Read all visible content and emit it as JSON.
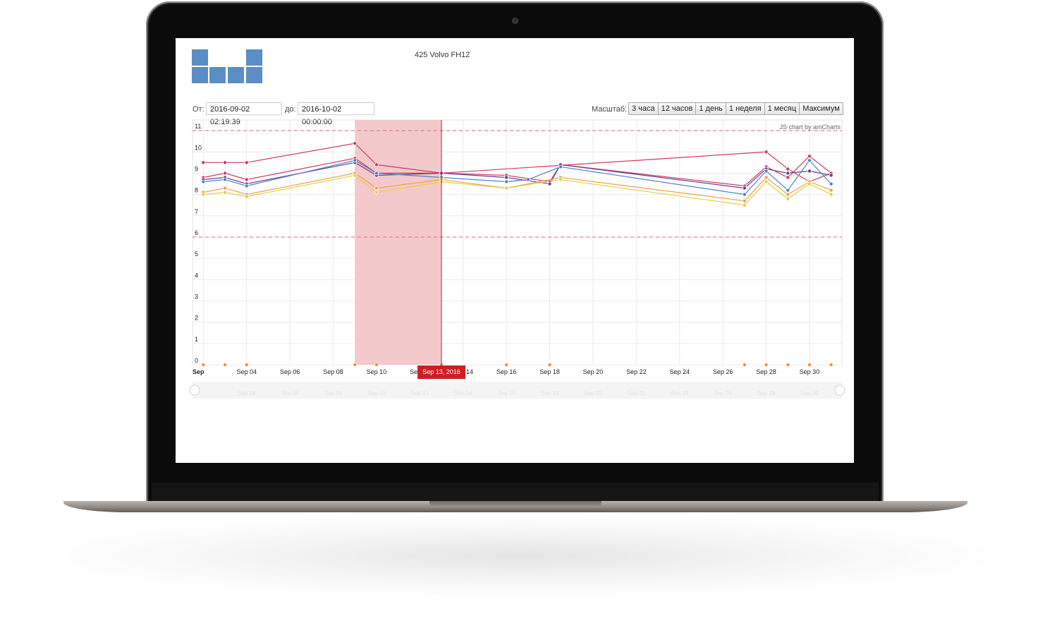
{
  "header": {
    "title": "425 Volvo FH12"
  },
  "period": {
    "from_label": "От:",
    "from_value": "2016-09-02 02:19:39",
    "to_label": "до:",
    "to_value": "2016-10-02 00:00:00"
  },
  "zoom": {
    "label": "Масштаб:",
    "buttons": [
      "3 часа",
      "12 часов",
      "1 день",
      "1 неделя",
      "1 месяц",
      "Максимум"
    ]
  },
  "chart_credit": "JS chart by amCharts",
  "cursor_label": "Sep 13, 2016",
  "colors": {
    "red": "#d13a63",
    "purple": "#6b3f8c",
    "blue": "#4a86c8",
    "orange": "#f0a04b",
    "yellow": "#e3d13c",
    "guide": "#e06a7b",
    "selection": "#f3c9cc",
    "cursor": "#cc1f24"
  },
  "chart_data": {
    "type": "line",
    "y_ticks": [
      "0",
      "1",
      "2",
      "3",
      "4",
      "5",
      "6",
      "7",
      "8",
      "9",
      "10",
      "11"
    ],
    "ylim": [
      0,
      11.5
    ],
    "guides": [
      6,
      11
    ],
    "x_ticks": [
      "Sep",
      "Sep 04",
      "Sep 06",
      "Sep 08",
      "Sep 10",
      "Sep 12",
      "Sep 14",
      "Sep 16",
      "Sep 18",
      "Sep 20",
      "Sep 22",
      "Sep 24",
      "Sep 26",
      "Sep 28",
      "Sep 30"
    ],
    "x_tick_days": [
      2,
      4,
      6,
      8,
      10,
      12,
      14,
      16,
      18,
      20,
      22,
      24,
      26,
      28,
      30
    ],
    "xlim_days": [
      1.5,
      31.5
    ],
    "selection_days": [
      9.0,
      13.0
    ],
    "cursor_day": 13.0,
    "series": [
      {
        "color": "red",
        "points": [
          [
            2,
            9.5
          ],
          [
            3,
            9.5
          ],
          [
            4,
            9.5
          ],
          [
            9,
            10.4
          ],
          [
            10,
            9.4
          ],
          [
            13,
            9.0
          ],
          [
            28,
            10.0
          ],
          [
            29,
            9.2
          ],
          [
            30,
            8.6
          ],
          [
            31,
            9.0
          ]
        ]
      },
      {
        "color": "red",
        "points": [
          [
            2,
            8.8
          ],
          [
            3,
            9.0
          ],
          [
            4,
            8.7
          ],
          [
            9,
            9.7
          ],
          [
            10,
            9.0
          ],
          [
            13,
            9.0
          ],
          [
            16,
            8.9
          ],
          [
            18,
            8.6
          ],
          [
            18.5,
            9.4
          ],
          [
            27,
            8.4
          ],
          [
            28,
            9.3
          ],
          [
            29,
            8.8
          ],
          [
            30,
            9.8
          ],
          [
            31,
            9.0
          ]
        ]
      },
      {
        "color": "purple",
        "points": [
          [
            2,
            8.7
          ],
          [
            3,
            8.8
          ],
          [
            4,
            8.5
          ],
          [
            9,
            9.5
          ],
          [
            10,
            8.9
          ],
          [
            13,
            9.0
          ],
          [
            16,
            8.8
          ],
          [
            18,
            8.5
          ],
          [
            18.5,
            9.4
          ],
          [
            27,
            8.3
          ],
          [
            28,
            9.2
          ],
          [
            29,
            9.0
          ],
          [
            30,
            9.1
          ],
          [
            31,
            8.9
          ]
        ]
      },
      {
        "color": "blue",
        "points": [
          [
            2,
            8.6
          ],
          [
            3,
            8.7
          ],
          [
            4,
            8.4
          ],
          [
            9,
            9.6
          ],
          [
            10,
            9.0
          ],
          [
            13,
            8.8
          ],
          [
            16,
            8.6
          ],
          [
            17,
            8.7
          ],
          [
            18.5,
            9.3
          ],
          [
            27,
            8.0
          ],
          [
            28,
            9.1
          ],
          [
            29,
            8.2
          ],
          [
            30,
            9.6
          ],
          [
            31,
            8.5
          ]
        ]
      },
      {
        "color": "orange",
        "points": [
          [
            2,
            8.1
          ],
          [
            3,
            8.3
          ],
          [
            4,
            8.0
          ],
          [
            9,
            9.0
          ],
          [
            10,
            8.3
          ],
          [
            13,
            8.7
          ],
          [
            16,
            8.3
          ],
          [
            18.5,
            8.8
          ],
          [
            27,
            7.7
          ],
          [
            28,
            8.8
          ],
          [
            29,
            8.0
          ],
          [
            30,
            8.6
          ],
          [
            31,
            8.2
          ]
        ]
      },
      {
        "color": "yellow",
        "points": [
          [
            2,
            8.0
          ],
          [
            3,
            8.1
          ],
          [
            4,
            7.9
          ],
          [
            9,
            8.9
          ],
          [
            10,
            8.1
          ],
          [
            13,
            8.6
          ],
          [
            16,
            8.3
          ],
          [
            18.5,
            8.7
          ],
          [
            27,
            7.5
          ],
          [
            28,
            8.6
          ],
          [
            29,
            7.8
          ],
          [
            30,
            8.5
          ],
          [
            31,
            8.0
          ]
        ]
      }
    ],
    "zero_marker_days": [
      2,
      3,
      4,
      9,
      10,
      13,
      16,
      18,
      27,
      28,
      29,
      30,
      31
    ]
  }
}
